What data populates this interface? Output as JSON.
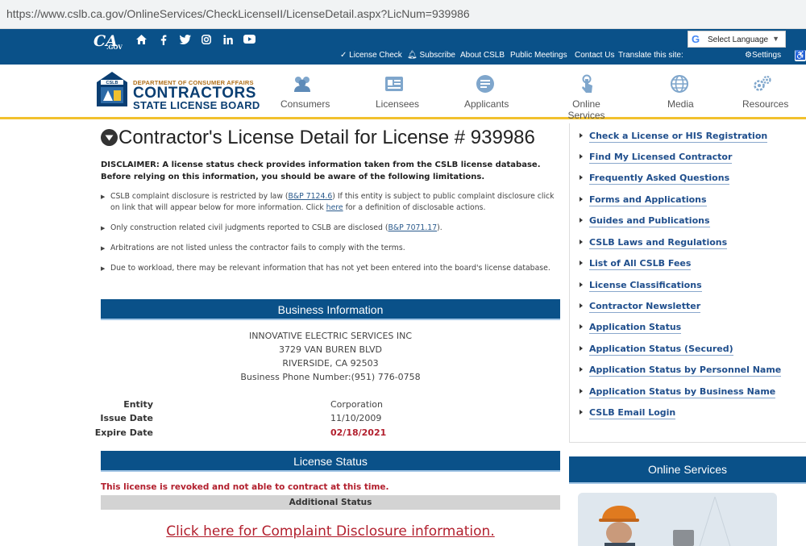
{
  "browser": {
    "url": "https://www.cslb.ca.gov/OnlineServices/CheckLicenseII/LicenseDetail.aspx?LicNum=939986"
  },
  "topbar": {
    "cagov_logo": "CA",
    "cagov_suffix": ".GOV",
    "social_icons": [
      "home-icon",
      "facebook-icon",
      "twitter-icon",
      "instagram-icon",
      "linkedin-icon",
      "youtube-icon"
    ],
    "links": [
      "License Check",
      "Subscribe",
      "About CSLB",
      "Public Meetings",
      "Contact Us"
    ],
    "translate_label": "Translate this site:",
    "language_select": "Select Language",
    "settings_label": "Settings"
  },
  "header": {
    "logo": {
      "badge": "CSLB",
      "dept": "DEPARTMENT OF CONSUMER AFFAIRS",
      "line1": "CONTRACTORS",
      "line2": "STATE LICENSE BOARD"
    },
    "nav": [
      {
        "label": "Consumers",
        "icon": "consumers-icon"
      },
      {
        "label": "Licensees",
        "icon": "licensees-icon"
      },
      {
        "label": "Applicants",
        "icon": "applicants-icon"
      },
      {
        "label": "Online Services",
        "icon": "online-services-icon"
      },
      {
        "label": "Media",
        "icon": "media-icon"
      },
      {
        "label": "Resources",
        "icon": "resources-icon"
      }
    ]
  },
  "main": {
    "title": "Contractor's License Detail for License # 939986",
    "disclaimer": "DISCLAIMER: A license status check provides information taken from the CSLB license database. Before relying on this information, you should be aware of the following limitations.",
    "bullets": [
      {
        "pre": "CSLB complaint disclosure is restricted by law (",
        "link": "B&P 7124.6",
        "mid": ") If this entity is subject to public complaint disclosure click on link that will appear below for more information. Click ",
        "link2": "here",
        "post": " for a definition of disclosable actions."
      },
      {
        "pre": "Only construction related civil judgments reported to CSLB are disclosed (",
        "link": "B&P 7071.17",
        "post": ")."
      },
      {
        "text": "Arbitrations are not listed unless the contractor fails to comply with the terms."
      },
      {
        "text": "Due to workload, there may be relevant information that has not yet been entered into the board's license database."
      }
    ],
    "business_info": {
      "heading": "Business Information",
      "name": "INNOVATIVE ELECTRIC SERVICES INC",
      "street": "3729 VAN BUREN BLVD",
      "city": "RIVERSIDE, CA 92503",
      "phone": "Business Phone Number:(951) 776-0758",
      "entity_label": "Entity",
      "entity_value": "Corporation",
      "issue_label": "Issue Date",
      "issue_value": "11/10/2009",
      "expire_label": "Expire Date",
      "expire_value": "02/18/2021"
    },
    "license_status": {
      "heading": "License Status",
      "message": "This license is revoked and not able to contract at this time.",
      "additional": "Additional Status",
      "complaint_link": "Click here for Complaint Disclosure information."
    }
  },
  "sidebar": {
    "links": [
      "Check a License or HIS Registration",
      "Find My Licensed Contractor",
      "Frequently Asked Questions",
      "Forms and Applications",
      "Guides and Publications",
      "CSLB Laws and Regulations",
      "List of All CSLB Fees",
      "License Classifications",
      "Contractor Newsletter",
      "Application Status",
      "Application Status (Secured)",
      "Application Status by Personnel Name",
      "Application Status by Business Name",
      "CSLB Email Login"
    ],
    "online_services_heading": "Online Services"
  },
  "colors": {
    "primary_blue": "#0a5189",
    "accent_gold": "#f2c12e",
    "alert_red": "#b21f2d",
    "link_blue": "#1f4e8c"
  }
}
